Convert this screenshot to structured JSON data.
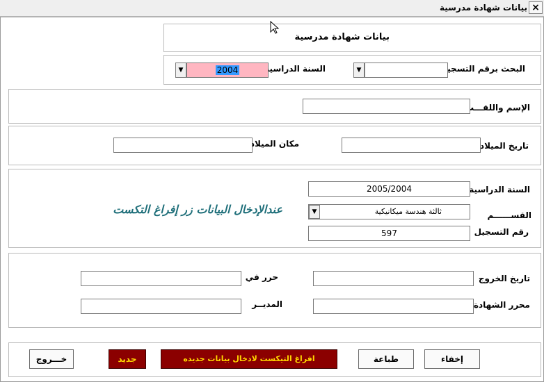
{
  "window": {
    "title": "بيانات شهادة مدرسية",
    "close": "×"
  },
  "header": {
    "title": "بيانات شهادة مدرسية"
  },
  "search": {
    "by_reg_label": "البحث برقم التسجيل",
    "by_reg_value": "",
    "year_label": "السنة الدراسية",
    "year_value": "2004",
    "dropdown_glyph": "▼"
  },
  "identity": {
    "name_label": "الإسم واللقـــب",
    "name_value": ""
  },
  "birth": {
    "date_label": "تاريخ الميلاد",
    "date_value": "",
    "place_label": "مكان الميلاد",
    "place_value": ""
  },
  "study": {
    "year_label": "السنة الدراسية",
    "year_value": "2005/2004",
    "dept_label": "القســــــم",
    "dept_value": "ثالثة هندسة ميكانيكية",
    "reg_label": "رقم التسجيل",
    "reg_value": "597",
    "note": "عندالإدخال البيانات زر إفراغ التكست"
  },
  "certificate": {
    "exit_date_label": "تاريخ الخروج",
    "exit_date_value": "",
    "written_in_label": "حرر في",
    "written_in_value": "",
    "writer_label": "محرر الشهادة",
    "writer_value": "",
    "director_label": "المديــر",
    "director_value": ""
  },
  "buttons": {
    "hide": "إخفاء",
    "print": "طباعة",
    "clear": "افراغ التيكست لادخال بيانات جديده",
    "new": "جديد",
    "exit": "خـــروج"
  },
  "colors": {
    "highlight_field": "#ffb6c1",
    "selection": "#3399ff",
    "accent_note": "#1f6f7a",
    "button_red": "#8b0000",
    "button_text": "#ffd700"
  }
}
